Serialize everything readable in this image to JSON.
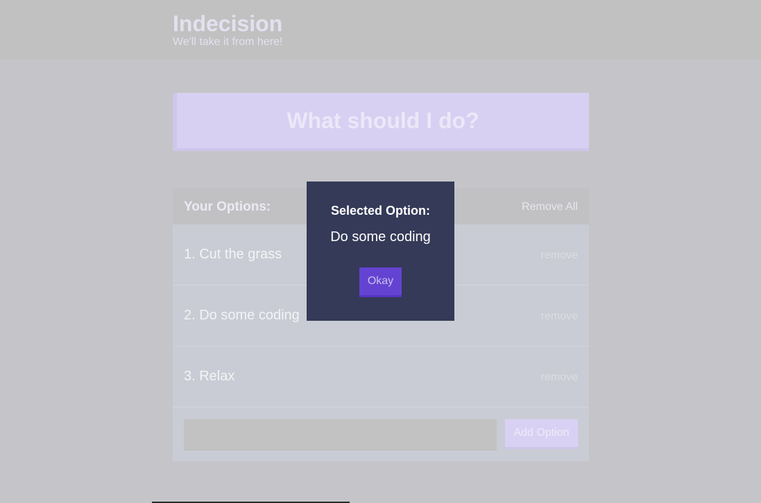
{
  "header": {
    "title": "Indecision",
    "subtitle": "We'll take it from here!"
  },
  "action": {
    "label": "What should I do?"
  },
  "options": {
    "title": "Your Options:",
    "remove_all_label": "Remove All",
    "items": [
      {
        "label": "1. Cut the grass",
        "remove_label": "remove"
      },
      {
        "label": "2. Do some coding",
        "remove_label": "remove"
      },
      {
        "label": "3. Relax",
        "remove_label": "remove"
      }
    ],
    "add_input_value": "",
    "add_button_label": "Add Option"
  },
  "modal": {
    "title": "Selected Option:",
    "selected": "Do some coding",
    "okay_label": "Okay"
  }
}
